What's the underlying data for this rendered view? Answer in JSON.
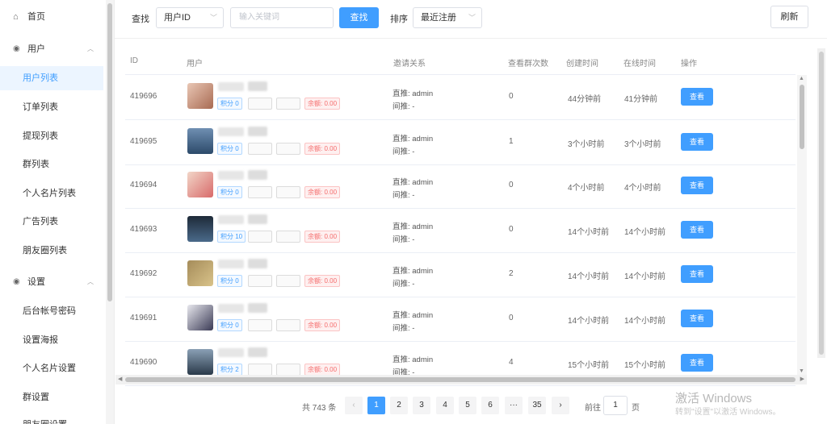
{
  "sidebar": {
    "home": "首页",
    "group_user": "用户",
    "user_items": [
      "用户列表",
      "订单列表",
      "提现列表",
      "群列表",
      "个人名片列表",
      "广告列表",
      "朋友圈列表"
    ],
    "group_settings": "设置",
    "settings_items": [
      "后台帐号密码",
      "设置海报",
      "个人名片设置",
      "群设置",
      "朋友圈设置"
    ]
  },
  "toolbar": {
    "search_label": "查找",
    "search_field": "用户ID",
    "search_placeholder": "输入关键词",
    "search_button": "查找",
    "sort_label": "排序",
    "sort_value": "最近注册",
    "refresh_button": "刷新"
  },
  "table": {
    "headers": [
      "ID",
      "用户",
      "邀请关系",
      "查看群次数",
      "创建时间",
      "在线时间",
      "操作"
    ],
    "rows": [
      {
        "id": "419696",
        "points": "积分 0",
        "balance": "余额: 0.00",
        "direct": "直推: admin",
        "indirect": "间推: -",
        "views": "0",
        "created": "44分钟前",
        "online": "41分钟前",
        "action": "查看"
      },
      {
        "id": "419695",
        "points": "积分 0",
        "balance": "余额: 0.00",
        "direct": "直推: admin",
        "indirect": "间推: -",
        "views": "1",
        "created": "3个小时前",
        "online": "3个小时前",
        "action": "查看"
      },
      {
        "id": "419694",
        "points": "积分 0",
        "balance": "余额: 0.00",
        "direct": "直推: admin",
        "indirect": "间推: -",
        "views": "0",
        "created": "4个小时前",
        "online": "4个小时前",
        "action": "查看"
      },
      {
        "id": "419693",
        "points": "积分 10",
        "balance": "余额: 0.00",
        "direct": "直推: admin",
        "indirect": "间推: -",
        "views": "0",
        "created": "14个小时前",
        "online": "14个小时前",
        "action": "查看"
      },
      {
        "id": "419692",
        "points": "积分 0",
        "balance": "余额: 0.00",
        "direct": "直推: admin",
        "indirect": "间推: -",
        "views": "2",
        "created": "14个小时前",
        "online": "14个小时前",
        "action": "查看"
      },
      {
        "id": "419691",
        "points": "积分 0",
        "balance": "余额: 0.00",
        "direct": "直推: admin",
        "indirect": "间推: -",
        "views": "0",
        "created": "14个小时前",
        "online": "14个小时前",
        "action": "查看"
      },
      {
        "id": "419690",
        "points": "积分 2",
        "balance": "余额: 0.00",
        "direct": "直推: admin",
        "indirect": "间推: -",
        "views": "4",
        "created": "15个小时前",
        "online": "15个小时前",
        "action": "查看"
      }
    ]
  },
  "pagination": {
    "total": "共 743 条",
    "prev": "‹",
    "pages": [
      "1",
      "2",
      "3",
      "4",
      "5",
      "6",
      "···",
      "35"
    ],
    "next": "›",
    "goto_label": "前往",
    "goto_value": "1",
    "goto_suffix": "页"
  },
  "watermark": {
    "line1": "激活 Windows",
    "line2": "转到\"设置\"以激活 Windows。"
  },
  "colors": {
    "accent": "#409eff",
    "danger": "#f56c6c"
  }
}
